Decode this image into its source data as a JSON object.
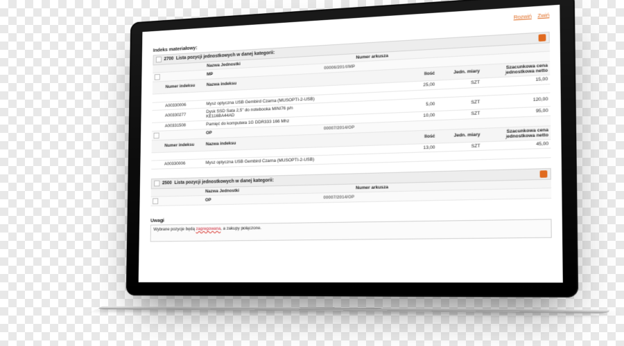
{
  "top_links": {
    "rozwin": "Rozwiń",
    "zwin": "Zwiń"
  },
  "section_label": "Indeks materiałowy:",
  "categories": [
    {
      "key": "cat2700",
      "code": "2700",
      "title": "Lista pozycji jednostkowych w danej kategorii:",
      "composite_header": {
        "jednostka": "Nazwa Jednostki",
        "arkusz": "Numer arkusza"
      },
      "sheets": [
        {
          "key": "mp",
          "code": "MP",
          "arkusz": "00006/2014/MP",
          "header": {
            "index": "Numer indeksu",
            "nazwa": "Nazwa indeksu",
            "ilosc": "Ilość",
            "jedn": "Jedn. miary",
            "cena": "Szacunkowa cena jednostkowa netto"
          },
          "items": [
            {
              "index": "",
              "nazwa": "",
              "ilosc": "25,00",
              "jedn": "SZT",
              "cena": "15,00"
            },
            {
              "index": "A00330006",
              "nazwa": "Mysz optyczna USB Gembird Czarna (MUSOPTI-2-USB)",
              "ilosc": "",
              "jedn": "",
              "cena": ""
            },
            {
              "index": "A00330277",
              "nazwa": "Dysk SSD Sata 2,5\" do notebooka MINI76 p/n KE116BA44AD",
              "ilosc": "5,00",
              "jedn": "SZT",
              "cena": "120,00"
            },
            {
              "index": "A00331508",
              "nazwa": "Pamięć do komputera 1G DDR333 166 Mhz",
              "ilosc": "10,00",
              "jedn": "SZT",
              "cena": "95,00"
            }
          ]
        },
        {
          "key": "op",
          "code": "OP",
          "arkusz": "00007/2014/OP",
          "header": {
            "index": "Numer indeksu",
            "nazwa": "Nazwa indeksu",
            "ilosc": "Ilość",
            "jedn": "Jedn. miary",
            "cena": "Szacunkowa cena jednostkowa netto"
          },
          "items": [
            {
              "index": "",
              "nazwa": "",
              "ilosc": "13,00",
              "jedn": "SZT",
              "cena": "45,00"
            },
            {
              "index": "A00330006",
              "nazwa": "Mysz optyczna USB Gembird Czarna (MUSOPTI-2-USB)",
              "ilosc": "",
              "jedn": "",
              "cena": ""
            }
          ]
        }
      ]
    },
    {
      "key": "cat2500",
      "code": "2500",
      "title": "Lista pozycji jednostkowych w danej kategorii:",
      "composite_header": {
        "jednostka": "Nazwa Jednostki",
        "arkusz": "Numer arkusza"
      },
      "sheets": [
        {
          "key": "op2",
          "code": "OP",
          "arkusz": "00007/2014/OP"
        }
      ]
    }
  ],
  "remarks": {
    "label": "Uwagi",
    "text_pre": "Wybrane pozycje będą ",
    "text_err": "zagregowana",
    "text_post": ", a zakupy połączone."
  }
}
